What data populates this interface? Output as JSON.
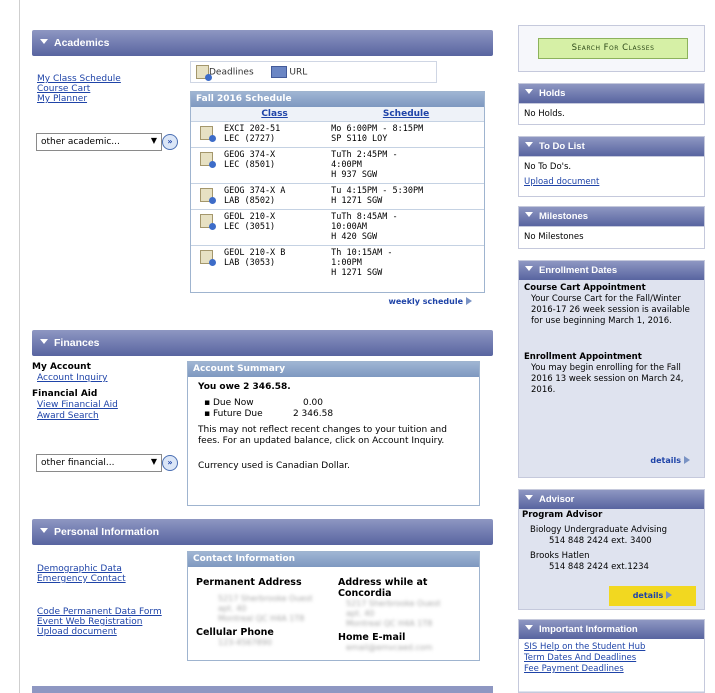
{
  "academics": {
    "title": "Academics",
    "links": [
      "My Class Schedule",
      "Course Cart",
      "My Planner"
    ],
    "select": "other academic...",
    "tabs": {
      "deadlines": "Deadlines",
      "url": "URL"
    },
    "schedule": {
      "title": "Fall 2016 Schedule",
      "col_class": "Class",
      "col_schedule": "Schedule",
      "rows": [
        {
          "c1": "EXCI 202-51",
          "c2": "LEC (2727)",
          "s1": "Mo 6:00PM - 8:15PM",
          "s2": "SP S110 LOY",
          "s3": ""
        },
        {
          "c1": "GEOG 374-X",
          "c2": "LEC (8501)",
          "s1": "TuTh 2:45PM -",
          "s2": "4:00PM",
          "s3": "H 937 SGW"
        },
        {
          "c1": "GEOG 374-X A",
          "c2": "LAB (8502)",
          "s1": "Tu 4:15PM - 5:30PM",
          "s2": "H 1271 SGW",
          "s3": ""
        },
        {
          "c1": "GEOL 210-X",
          "c2": "LEC (3051)",
          "s1": "TuTh 8:45AM -",
          "s2": "10:00AM",
          "s3": "H 420 SGW"
        },
        {
          "c1": "GEOL 210-X B",
          "c2": "LAB (3053)",
          "s1": "Th 10:15AM -",
          "s2": "1:00PM",
          "s3": "H 1271 SGW"
        }
      ],
      "weekly": "weekly schedule"
    }
  },
  "finances": {
    "title": "Finances",
    "my_account": "My Account",
    "account_inquiry": "Account Inquiry",
    "financial_aid": "Financial Aid",
    "view_aid": "View Financial Aid",
    "award_search": "Award Search",
    "select": "other financial...",
    "summary": {
      "title": "Account Summary",
      "owe": "You owe 2 346.58.",
      "due_now_label": "Due Now",
      "due_now": "0.00",
      "future_label": "Future Due",
      "future": "2 346.58",
      "note": "This may not reflect recent changes to your tuition and fees.  For an updated balance, click on Account Inquiry.",
      "currency": "Currency used is Canadian Dollar."
    }
  },
  "personal": {
    "title": "Personal Information",
    "links": [
      "Demographic Data",
      "Emergency Contact"
    ],
    "links2": [
      "Code Permanent Data Form",
      "Event Web Registration",
      "Upload document"
    ],
    "contact": {
      "title": "Contact Information",
      "perm": "Permanent Address",
      "while1": "Address while at",
      "while2": "Concordia",
      "cell": "Cellular Phone",
      "home": "Home E-mail",
      "blur_perm": [
        "5217 Sherbrooke Ouest",
        "apt. 40",
        "Montreal QC H4A 1T8"
      ],
      "blur_while": [
        "5217 Sherbrooke Ouest",
        "apt. 40",
        "Montreal QC H4A 1T8"
      ],
      "blur_cell": "123-4567890",
      "blur_email": "email@emvcaed.com"
    }
  },
  "sidebar": {
    "search": "Search For Classes",
    "holds": {
      "title": "Holds",
      "body": "No Holds."
    },
    "todo": {
      "title": "To Do List",
      "body": "No To Do's.",
      "link": "Upload document"
    },
    "milestones": {
      "title": "Milestones",
      "body": "No Milestones"
    },
    "enroll": {
      "title": "Enrollment Dates",
      "cc_title": "Course Cart Appointment",
      "cc_text": "Your Course Cart for the Fall/Winter 2016-17 26 week session is available for use beginning March 1, 2016.",
      "ea_title": "Enrollment Appointment",
      "ea_text": "You may begin enrolling for the Fall 2016 13 week session on March 24, 2016.",
      "details": "details"
    },
    "advisor": {
      "title": "Advisor",
      "program": "Program Advisor",
      "a1": "Biology Undergraduate Advising",
      "a1p": "514 848 2424 ext. 3400",
      "a2": "Brooks Hatlen",
      "a2p": "514 848 2424 ext.1234",
      "details": "details"
    },
    "info": {
      "title": "Important Information",
      "links": [
        "SIS Help on the Student Hub",
        "Term Dates And Deadlines",
        "Fee Payment Deadlines"
      ]
    }
  },
  "colors": {
    "header": "#6a74ab",
    "link": "#1f44a8",
    "highlight": "#f2d820"
  }
}
